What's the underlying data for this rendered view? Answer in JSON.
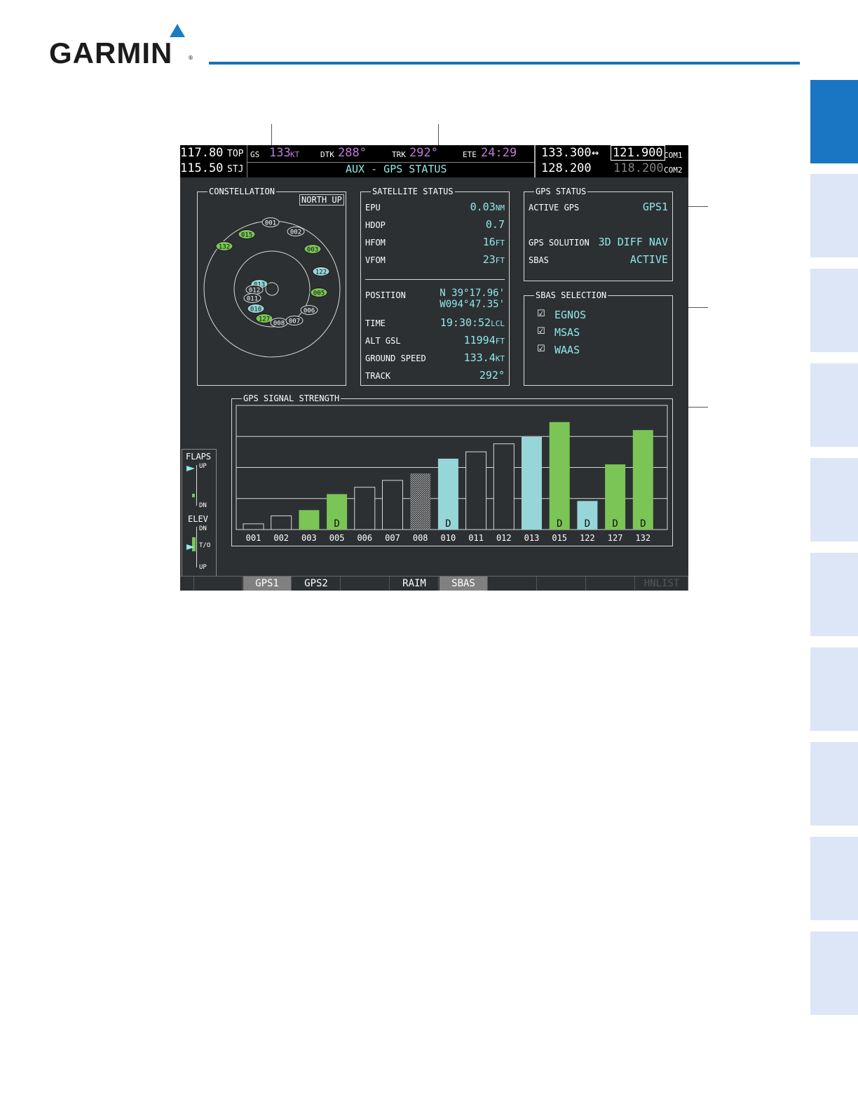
{
  "brand": {
    "name": "GARMIN",
    "reg": "®"
  },
  "status_bar": {
    "nav1": "117.80",
    "nav1_id": "TOP",
    "nav2": "115.50",
    "nav2_id": "STJ",
    "gs_label": "GS",
    "gs_value": "133",
    "gs_unit": "KT",
    "dtk_label": "DTK",
    "dtk_value": "288°",
    "trk_label": "TRK",
    "trk_value": "292°",
    "ete_label": "ETE",
    "ete_value": "24:29",
    "page_title": "AUX - GPS STATUS",
    "com1_standby": "133.300",
    "com1_active": "121.900",
    "com1_label": "COM1",
    "com2_standby": "128.200",
    "com2_active": "118.200",
    "com2_label": "COM2",
    "swap_icon": "↔"
  },
  "constellation": {
    "title": "CONSTELLATION",
    "orientation": "NORTH UP",
    "satellites": [
      {
        "id": "001",
        "state": "outline"
      },
      {
        "id": "002",
        "state": "outline"
      },
      {
        "id": "003",
        "state": "green"
      },
      {
        "id": "015",
        "state": "green"
      },
      {
        "id": "132",
        "state": "green"
      },
      {
        "id": "122",
        "state": "cyan"
      },
      {
        "id": "013",
        "state": "cyan"
      },
      {
        "id": "012",
        "state": "outline"
      },
      {
        "id": "011",
        "state": "outline"
      },
      {
        "id": "005",
        "state": "green"
      },
      {
        "id": "010",
        "state": "cyan"
      },
      {
        "id": "006",
        "state": "outline"
      },
      {
        "id": "127",
        "state": "green"
      },
      {
        "id": "008",
        "state": "outline"
      },
      {
        "id": "007",
        "state": "outline"
      }
    ]
  },
  "satellite_status": {
    "title": "SATELLITE STATUS",
    "epu_label": "EPU",
    "epu_value": "0.03",
    "epu_unit": "NM",
    "hdop_label": "HDOP",
    "hdop_value": "0.7",
    "hfom_label": "HFOM",
    "hfom_value": "16",
    "hfom_unit": "FT",
    "vfom_label": "VFOM",
    "vfom_value": "23",
    "vfom_unit": "FT",
    "position_label": "POSITION",
    "lat": "N 39°17.96'",
    "lon": "W094°47.35'",
    "time_label": "TIME",
    "time_value": "19:30:52",
    "time_unit": "LCL",
    "alt_label": "ALT GSL",
    "alt_value": "11994",
    "alt_unit": "FT",
    "gspd_label": "GROUND SPEED",
    "gspd_value": "133.4",
    "gspd_unit": "KT",
    "track_label": "TRACK",
    "track_value": "292°"
  },
  "gps_status": {
    "title": "GPS STATUS",
    "active_label": "ACTIVE GPS",
    "active_value": "GPS1",
    "solution_label": "GPS SOLUTION",
    "solution_value": "3D DIFF NAV",
    "sbas_label": "SBAS",
    "sbas_value": "ACTIVE"
  },
  "sbas_selection": {
    "title": "SBAS SELECTION",
    "items": [
      {
        "label": "EGNOS",
        "checked": true
      },
      {
        "label": "MSAS",
        "checked": true
      },
      {
        "label": "WAAS",
        "checked": true
      }
    ]
  },
  "flaps": {
    "title": "FLAPS",
    "up": "UP",
    "dn": "DN"
  },
  "elev": {
    "title": "ELEV",
    "dn": "DN",
    "to": "T/O",
    "up": "UP"
  },
  "chart_data": {
    "type": "bar",
    "title": "GPS SIGNAL STRENGTH",
    "categories": [
      "001",
      "002",
      "003",
      "005",
      "006",
      "007",
      "008",
      "010",
      "011",
      "012",
      "013",
      "015",
      "122",
      "127",
      "132"
    ],
    "values": [
      0.05,
      0.12,
      0.17,
      0.31,
      0.37,
      0.43,
      0.49,
      0.62,
      0.68,
      0.75,
      0.81,
      0.94,
      0.25,
      0.57,
      0.87
    ],
    "status": [
      "outline",
      "outline",
      "green",
      "green",
      "outline",
      "outline",
      "hatched",
      "cyan",
      "outline",
      "outline",
      "cyan",
      "green",
      "cyan",
      "green",
      "green"
    ],
    "diff_flag": [
      "",
      "",
      "",
      "D",
      "",
      "",
      "",
      "D",
      "",
      "",
      "",
      "D",
      "D",
      "D",
      "D"
    ],
    "ylim": [
      0,
      1
    ],
    "grid": true,
    "colors": {
      "green": "#7ac556",
      "cyan": "#96d6d8",
      "outline": "#d8d8d8"
    }
  },
  "softkeys": [
    "",
    "GPS1",
    "GPS2",
    "",
    "RAIM",
    "SBAS",
    "",
    "",
    "",
    "HNLIST"
  ]
}
